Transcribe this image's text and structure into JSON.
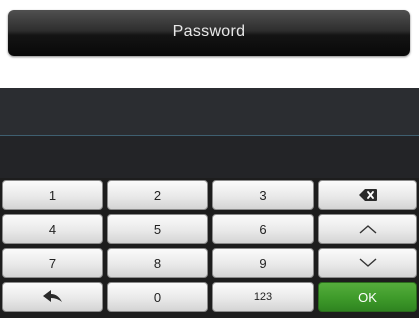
{
  "header": {
    "title": "Password"
  },
  "display": {
    "value": ""
  },
  "keypad": {
    "row1": {
      "k1": "1",
      "k2": "2",
      "k3": "3",
      "backspace_icon": "backspace-icon"
    },
    "row2": {
      "k1": "4",
      "k2": "5",
      "k3": "6",
      "up_icon": "chevron-up-icon"
    },
    "row3": {
      "k1": "7",
      "k2": "8",
      "k3": "9",
      "down_icon": "chevron-down-icon"
    },
    "row4": {
      "back_icon": "back-arrow-icon",
      "k0": "0",
      "mode": "123",
      "ok": "OK"
    }
  },
  "colors": {
    "ok_button": "#3e9a2a",
    "display_bg": "#2b2d31",
    "keypad_bg": "#1d1d1d"
  }
}
